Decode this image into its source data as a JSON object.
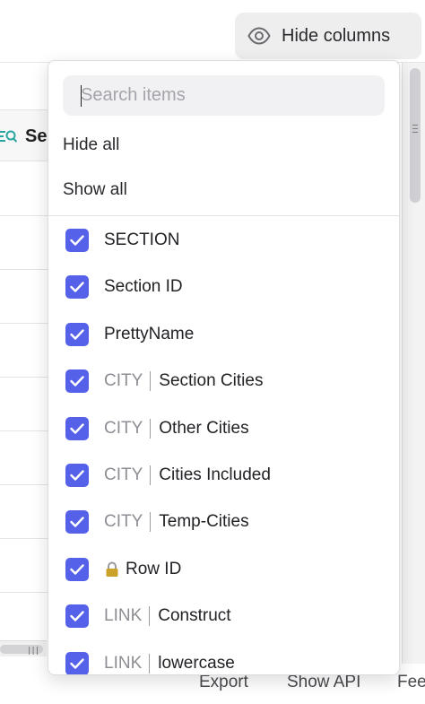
{
  "toolbar": {
    "hide_columns_label": "Hide columns",
    "hide_columns_icon": "eye-icon"
  },
  "grid": {
    "header_partial_label": "Se",
    "header_icon": "search-table-icon"
  },
  "dropdown": {
    "search_placeholder": "Search items",
    "search_value": "",
    "hide_all_label": "Hide all",
    "show_all_label": "Show all",
    "checkbox_color": "#5561e8",
    "items": [
      {
        "prefix": "",
        "label": "SECTION",
        "checked": true,
        "locked": false
      },
      {
        "prefix": "",
        "label": "Section ID",
        "checked": true,
        "locked": false
      },
      {
        "prefix": "",
        "label": "PrettyName",
        "checked": true,
        "locked": false
      },
      {
        "prefix": "CITY",
        "label": "Section Cities",
        "checked": true,
        "locked": false
      },
      {
        "prefix": "CITY",
        "label": "Other Cities",
        "checked": true,
        "locked": false
      },
      {
        "prefix": "CITY",
        "label": "Cities Included",
        "checked": true,
        "locked": false
      },
      {
        "prefix": "CITY",
        "label": "Temp-Cities",
        "checked": true,
        "locked": false
      },
      {
        "prefix": "",
        "label": "Row ID",
        "checked": true,
        "locked": true
      },
      {
        "prefix": "LINK",
        "label": "Construct",
        "checked": true,
        "locked": false
      },
      {
        "prefix": "LINK",
        "label": "lowercase",
        "checked": true,
        "locked": false
      }
    ]
  },
  "footer": {
    "export_label": "Export",
    "show_api_label": "Show API",
    "feedback_partial_label": "Fee"
  }
}
